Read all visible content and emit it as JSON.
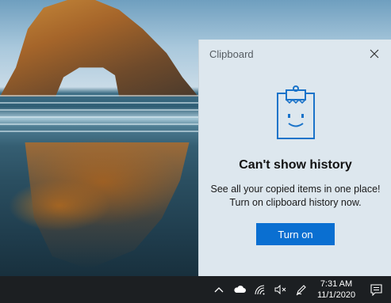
{
  "desktop": {
    "wallpaper": "rock-arch-beach-wallpaper"
  },
  "clipboard": {
    "title": "Clipboard",
    "close_icon": "close-icon",
    "illustration_icon": "clipboard-smiley-icon",
    "heading": "Can't show history",
    "description_line1": "See all your copied items in one place!",
    "description_line2": "Turn on clipboard history now.",
    "turn_on_label": "Turn on",
    "accent_color": "#0a6fd1"
  },
  "taskbar": {
    "tray_icons": [
      "chevron-up-icon",
      "cloud-icon",
      "wifi-icon",
      "speaker-muted-icon",
      "pen-icon"
    ],
    "time": "7:31 AM",
    "date": "11/1/2020",
    "notification_icon": "notification-icon"
  }
}
